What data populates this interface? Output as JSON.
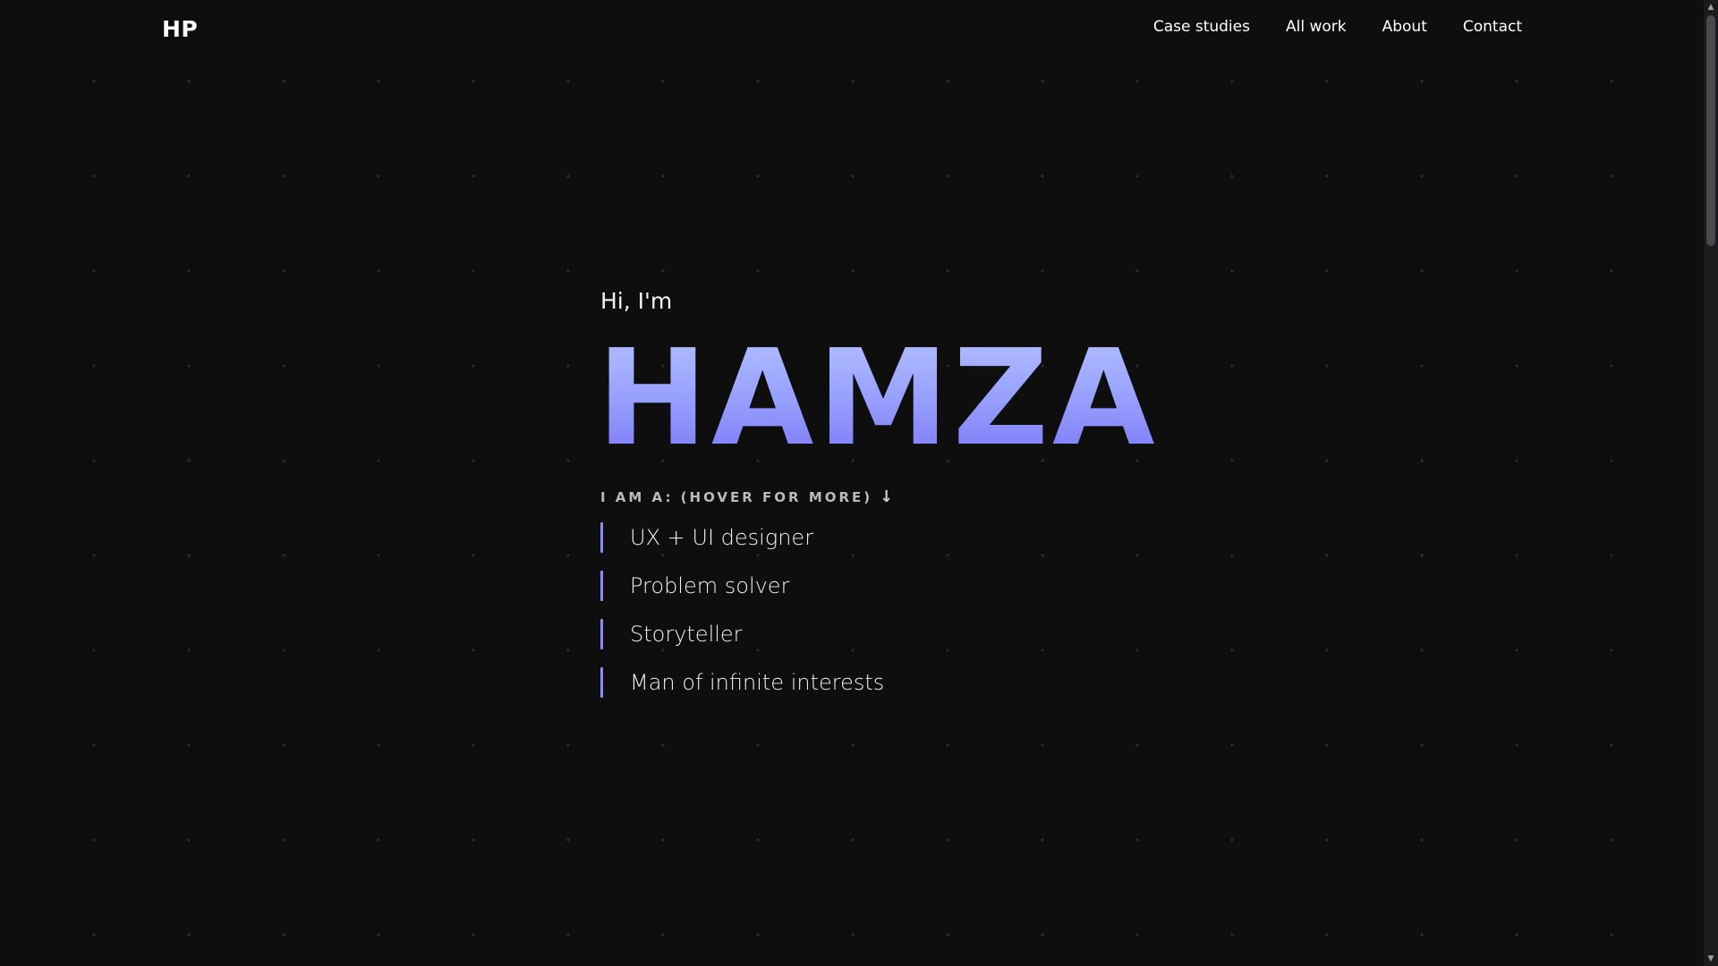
{
  "header": {
    "logo": "HP",
    "nav": [
      {
        "label": "Case studies"
      },
      {
        "label": "All work"
      },
      {
        "label": "About"
      },
      {
        "label": "Contact"
      }
    ]
  },
  "hero": {
    "greeting": "Hi, I'm",
    "name": "HAMZA",
    "subheading": "I AM A: (HOVER FOR MORE)",
    "arrow": "↓",
    "roles": [
      {
        "label": "UX + UI designer"
      },
      {
        "label": "Problem solver"
      },
      {
        "label": "Storyteller"
      },
      {
        "label": "Man of infinite interests"
      }
    ]
  },
  "colors": {
    "background": "#0e0e0f",
    "accent": "#8c8ef7",
    "name_gradient_top": "#b2c0ff",
    "name_gradient_bottom": "#7b78f5"
  },
  "scrollbar": {
    "up_icon": "▲",
    "down_icon": "▼"
  }
}
